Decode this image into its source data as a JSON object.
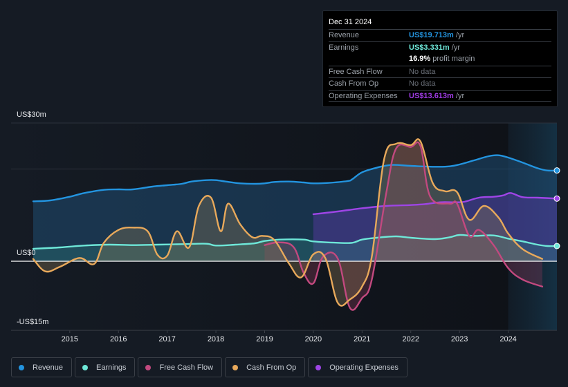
{
  "tooltip": {
    "date": "Dec 31 2024",
    "rows": [
      {
        "label": "Revenue",
        "value": "US$19.713m",
        "suffix": " /yr",
        "color": "#2394df"
      },
      {
        "label": "Earnings",
        "value": "US$3.331m",
        "suffix": " /yr",
        "color": "#6ee7d8"
      },
      {
        "label": "",
        "value": "16.9%",
        "suffix": " profit margin",
        "color": "#ffffff"
      },
      {
        "label": "Free Cash Flow",
        "value": "No data",
        "suffix": "",
        "color": "#6b7079"
      },
      {
        "label": "Cash From Op",
        "value": "No data",
        "suffix": "",
        "color": "#6b7079"
      },
      {
        "label": "Operating Expenses",
        "value": "US$13.613m",
        "suffix": " /yr",
        "color": "#a23de8"
      }
    ]
  },
  "legend": [
    {
      "label": "Revenue",
      "color": "#2394df"
    },
    {
      "label": "Earnings",
      "color": "#6ee7d8"
    },
    {
      "label": "Free Cash Flow",
      "color": "#c2497f"
    },
    {
      "label": "Cash From Op",
      "color": "#e8a95b"
    },
    {
      "label": "Operating Expenses",
      "color": "#9e45e6"
    }
  ],
  "chart_data": {
    "type": "area",
    "title": "",
    "xlabel": "",
    "ylabel": "",
    "unit": "US$ m",
    "ylim": [
      -15,
      30
    ],
    "xlim": [
      2014.25,
      2025.0
    ],
    "ytick_labels": [
      {
        "value": 30,
        "label": "US$30m"
      },
      {
        "value": 0,
        "label": "US$0"
      },
      {
        "value": -15,
        "label": "-US$15m"
      }
    ],
    "xtick_labels": [
      "2015",
      "2016",
      "2017",
      "2018",
      "2019",
      "2020",
      "2021",
      "2022",
      "2023",
      "2024"
    ],
    "xticks": [
      2015,
      2016,
      2017,
      2018,
      2019,
      2020,
      2021,
      2022,
      2023,
      2024
    ],
    "gridlines": [
      30,
      20
    ],
    "forecast_shade_from": 2024.0,
    "legend_position": "bottom",
    "series": [
      {
        "name": "Revenue",
        "color": "#2394df",
        "x": [
          2014.25,
          2014.6,
          2015.0,
          2015.3,
          2015.7,
          2016.0,
          2016.3,
          2016.7,
          2017.0,
          2017.3,
          2017.5,
          2017.8,
          2018.0,
          2018.2,
          2018.5,
          2018.8,
          2019.0,
          2019.2,
          2019.5,
          2019.8,
          2020.0,
          2020.3,
          2020.7,
          2020.8,
          2021.0,
          2021.3,
          2021.6,
          2022.0,
          2022.5,
          2022.8,
          2023.0,
          2023.3,
          2023.6,
          2023.8,
          2024.0,
          2024.3,
          2024.6,
          2024.8,
          2025.0
        ],
        "values": [
          13.0,
          13.2,
          14.0,
          14.8,
          15.5,
          15.6,
          15.6,
          16.2,
          16.5,
          16.8,
          17.3,
          17.6,
          17.6,
          17.3,
          16.9,
          16.8,
          16.9,
          17.2,
          17.3,
          17.1,
          16.9,
          17.0,
          17.4,
          17.8,
          19.3,
          20.3,
          20.9,
          20.7,
          20.5,
          20.6,
          21.0,
          21.9,
          22.8,
          23.0,
          22.5,
          21.4,
          20.2,
          19.7,
          19.7
        ]
      },
      {
        "name": "Earnings",
        "color": "#6ee7d8",
        "x": [
          2014.25,
          2014.8,
          2015.3,
          2015.8,
          2016.3,
          2016.8,
          2017.3,
          2017.8,
          2018.0,
          2018.4,
          2018.8,
          2019.0,
          2019.3,
          2019.8,
          2020.0,
          2020.5,
          2020.8,
          2021.0,
          2021.3,
          2021.7,
          2022.0,
          2022.5,
          2022.8,
          2023.0,
          2023.3,
          2023.7,
          2024.0,
          2024.3,
          2024.6,
          2024.8,
          2025.0
        ],
        "values": [
          2.7,
          3.0,
          3.4,
          3.6,
          3.5,
          3.6,
          3.7,
          3.8,
          3.4,
          3.6,
          3.9,
          4.4,
          4.7,
          4.7,
          4.3,
          4.0,
          4.0,
          4.7,
          5.1,
          5.4,
          5.1,
          4.8,
          5.2,
          5.7,
          5.5,
          5.6,
          4.9,
          4.3,
          3.6,
          3.3,
          3.3
        ]
      },
      {
        "name": "Free Cash Flow",
        "color": "#c2497f",
        "x": [
          2019.0,
          2019.3,
          2019.6,
          2019.8,
          2020.0,
          2020.2,
          2020.5,
          2020.75,
          2021.0,
          2021.2,
          2021.5,
          2021.7,
          2022.0,
          2022.2,
          2022.4,
          2022.8,
          2022.95,
          2023.2,
          2023.4,
          2023.7,
          2024.0,
          2024.3,
          2024.7
        ],
        "values": [
          3.5,
          4.1,
          3.0,
          -2.5,
          -4.8,
          1.0,
          0.6,
          -10.1,
          -8.0,
          -4.0,
          15.0,
          24.5,
          24.8,
          25.0,
          14.0,
          12.5,
          12.5,
          5.5,
          6.8,
          3.5,
          -1.5,
          -4.0,
          -5.5
        ]
      },
      {
        "name": "Cash From Op",
        "color": "#e8a95b",
        "x": [
          2014.25,
          2014.5,
          2014.8,
          2015.2,
          2015.5,
          2015.7,
          2016.0,
          2016.3,
          2016.6,
          2016.8,
          2017.0,
          2017.2,
          2017.45,
          2017.65,
          2017.9,
          2018.1,
          2018.25,
          2018.5,
          2018.75,
          2018.95,
          2019.2,
          2019.5,
          2019.75,
          2020.0,
          2020.25,
          2020.5,
          2020.75,
          2021.0,
          2021.2,
          2021.45,
          2021.7,
          2022.0,
          2022.2,
          2022.45,
          2022.7,
          2022.95,
          2023.2,
          2023.5,
          2023.8,
          2024.0,
          2024.3,
          2024.7
        ],
        "values": [
          0.5,
          -2.2,
          -1.2,
          0.7,
          -0.6,
          4.0,
          6.8,
          7.3,
          6.5,
          1.4,
          1.2,
          6.5,
          3.0,
          12.0,
          13.8,
          6.5,
          12.5,
          8.0,
          5.2,
          5.5,
          4.6,
          -0.5,
          -3.5,
          1.5,
          0.6,
          -9.0,
          -8.3,
          -5.5,
          1.0,
          22.0,
          25.5,
          25.2,
          26.0,
          17.0,
          15.2,
          15.0,
          9.0,
          12.0,
          9.5,
          6.0,
          2.6,
          0.5
        ]
      },
      {
        "name": "Operating Expenses",
        "color": "#9e45e6",
        "x": [
          2020.0,
          2020.5,
          2021.0,
          2021.5,
          2022.0,
          2022.3,
          2022.6,
          2022.9,
          2023.1,
          2023.4,
          2023.7,
          2023.9,
          2024.05,
          2024.3,
          2024.6,
          2025.0
        ],
        "values": [
          10.2,
          10.8,
          11.5,
          12.0,
          12.2,
          12.4,
          12.8,
          12.8,
          12.9,
          13.8,
          14.0,
          14.3,
          14.8,
          13.9,
          13.8,
          13.6
        ]
      }
    ]
  }
}
